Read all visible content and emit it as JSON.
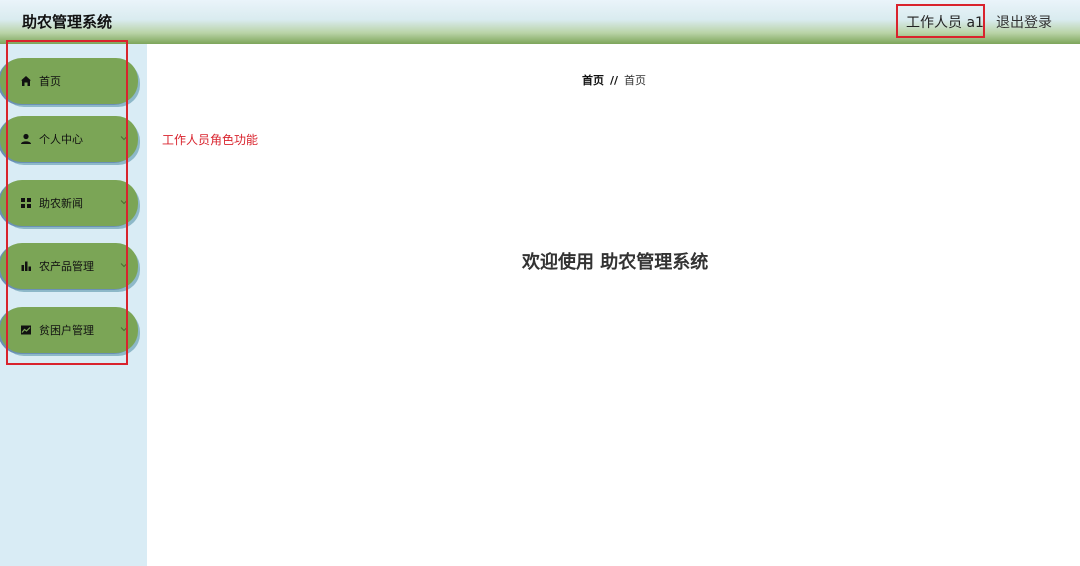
{
  "header": {
    "title": "助农管理系统",
    "user": "工作人员 a1",
    "logout": "退出登录"
  },
  "sidebar": {
    "items": [
      {
        "label": "首页",
        "icon": "home-icon"
      },
      {
        "label": "个人中心",
        "icon": "user-icon"
      },
      {
        "label": "助农新闻",
        "icon": "grid-icon"
      },
      {
        "label": "农产品管理",
        "icon": "bar-chart-icon"
      },
      {
        "label": "贫困户管理",
        "icon": "line-chart-icon"
      }
    ]
  },
  "breadcrumb": {
    "home": "首页",
    "separator": "//",
    "current": "首页"
  },
  "main": {
    "role_note": "工作人员角色功能",
    "welcome": "欢迎使用 助农管理系统"
  },
  "colors": {
    "accent_red": "#d9232d",
    "menu_green": "#7ba556",
    "sidebar_bg": "#d9ecf5"
  }
}
